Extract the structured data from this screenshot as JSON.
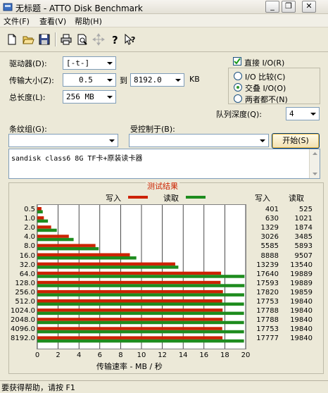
{
  "window": {
    "title": "无标题 - ATTO Disk Benchmark",
    "minimize_symbol": "_",
    "restore_symbol": "❐",
    "close_symbol": "✕"
  },
  "menu": {
    "file": "文件(F)",
    "view": "查看(V)",
    "help": "帮助(H)"
  },
  "toolbar_icons": [
    "new-icon",
    "open-icon",
    "save-icon",
    "print-icon",
    "print-preview-icon",
    "move-icon",
    "help-icon",
    "context-help-icon"
  ],
  "form": {
    "drive_label": "驱动器(D):",
    "drive_value": "[-t-]",
    "transfer_size_label": "传输大小(Z):",
    "transfer_from": "0.5",
    "transfer_to_label": "到",
    "transfer_to": "8192.0",
    "transfer_unit": "KB",
    "total_length_label": "总长度(L):",
    "total_length_value": "256 MB",
    "direct_io_label": "直接 I/O(R)",
    "direct_io_checked": true,
    "io_compare_label": "I/O 比较(C)",
    "overlapped_io_label": "交叠 I/O(O)",
    "neither_label": "两者都不(N)",
    "queue_depth_label": "队列深度(Q):",
    "queue_depth_value": "4",
    "stripe_group_label": "条纹组(G):",
    "controlled_by_label": "受控制于(B):",
    "start_button": "开始(S)",
    "description": "sandisk class6 8G TF卡+原装读卡器"
  },
  "results": {
    "title": "测试结果",
    "write_legend": "写入",
    "read_legend": "读取",
    "write_header": "写入",
    "read_header": "读取",
    "xlabel": "传输速率 - MB / 秒",
    "write_color": "#cc2200",
    "read_color": "#1e8c1e"
  },
  "chart_data": {
    "type": "bar",
    "orientation": "horizontal",
    "categories": [
      "0.5",
      "1.0",
      "2.0",
      "4.0",
      "8.0",
      "16.0",
      "32.0",
      "64.0",
      "128.0",
      "256.0",
      "512.0",
      "1024.0",
      "2048.0",
      "4096.0",
      "8192.0"
    ],
    "series": [
      {
        "name": "写入",
        "values": [
          401,
          630,
          1329,
          3026,
          5585,
          8888,
          13239,
          17640,
          17593,
          17820,
          17753,
          17788,
          17788,
          17753,
          17777
        ]
      },
      {
        "name": "读取",
        "values": [
          525,
          1021,
          1874,
          3485,
          5893,
          9507,
          13540,
          19889,
          19889,
          19859,
          19840,
          19840,
          19840,
          19840,
          19840
        ]
      }
    ],
    "xlabel": "传输速率 - MB / 秒",
    "x_ticks": [
      "0",
      "2",
      "4",
      "6",
      "8",
      "10",
      "12",
      "14",
      "16",
      "18",
      "20"
    ],
    "xlim": [
      0,
      20
    ],
    "value_unit_divisor": 1000,
    "grid": true,
    "legend": "top"
  },
  "status": {
    "text": "要获得帮助，请按 F1"
  }
}
